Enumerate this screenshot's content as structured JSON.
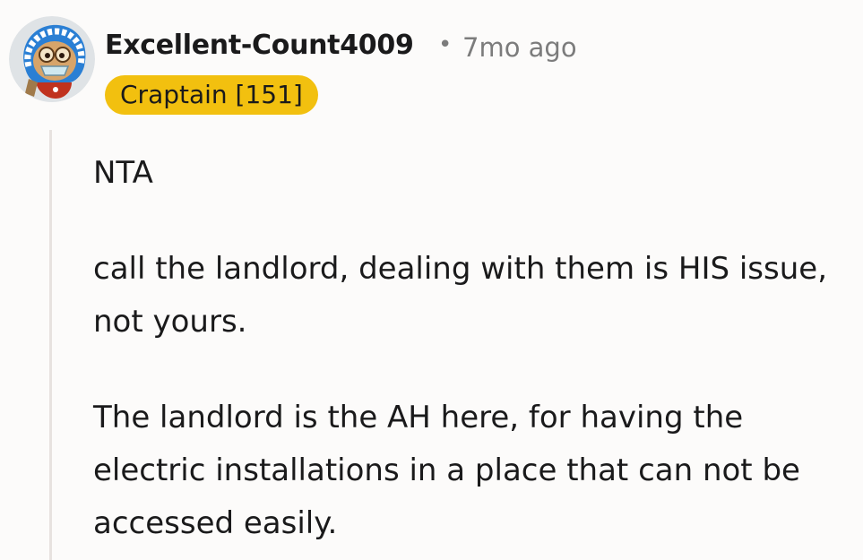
{
  "comment": {
    "author": "Excellent-Count4009",
    "separator": "•",
    "timestamp": "7mo ago",
    "flair": "Craptain [151]",
    "flair_color": "#f2c00f",
    "avatar_icon": "snoo-avatar-icon",
    "paragraphs": [
      "NTA",
      "call the landlord, dealing with them is HIS issue, not yours.",
      "The landlord is the AH here, for having the electric installations in a place that can not be accessed easily."
    ]
  }
}
